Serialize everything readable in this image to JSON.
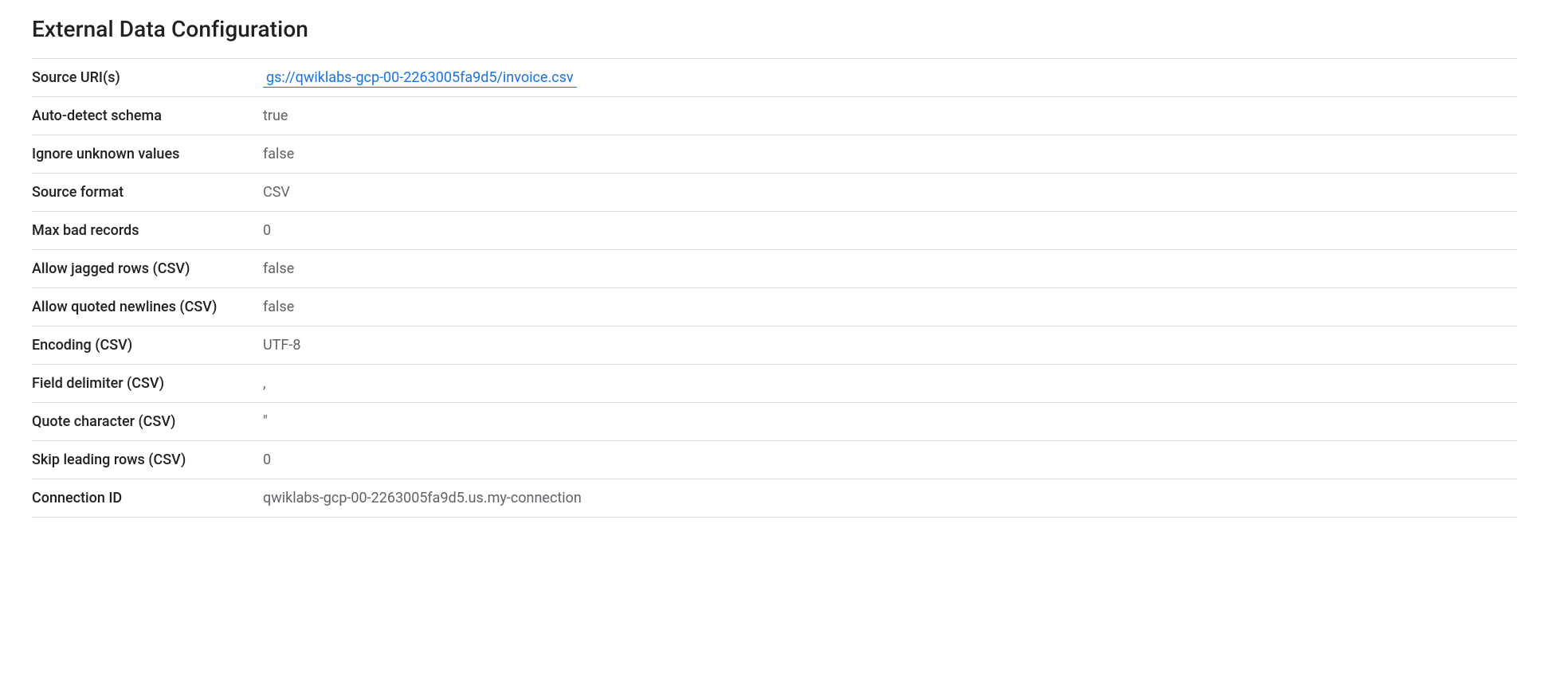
{
  "section": {
    "title": "External Data Configuration",
    "rows": [
      {
        "label": "Source URI(s)",
        "value": "gs://qwiklabs-gcp-00-2263005fa9d5/invoice.csv",
        "is_link": true
      },
      {
        "label": "Auto-detect schema",
        "value": "true",
        "is_link": false
      },
      {
        "label": "Ignore unknown values",
        "value": "false",
        "is_link": false
      },
      {
        "label": "Source format",
        "value": "CSV",
        "is_link": false
      },
      {
        "label": "Max bad records",
        "value": "0",
        "is_link": false
      },
      {
        "label": "Allow jagged rows (CSV)",
        "value": "false",
        "is_link": false
      },
      {
        "label": "Allow quoted newlines (CSV)",
        "value": "false",
        "is_link": false
      },
      {
        "label": "Encoding (CSV)",
        "value": "UTF-8",
        "is_link": false
      },
      {
        "label": "Field delimiter (CSV)",
        "value": ",",
        "is_link": false
      },
      {
        "label": "Quote character (CSV)",
        "value": "\"",
        "is_link": false
      },
      {
        "label": "Skip leading rows (CSV)",
        "value": "0",
        "is_link": false
      },
      {
        "label": "Connection ID",
        "value": "qwiklabs-gcp-00-2263005fa9d5.us.my-connection",
        "is_link": false
      }
    ]
  }
}
